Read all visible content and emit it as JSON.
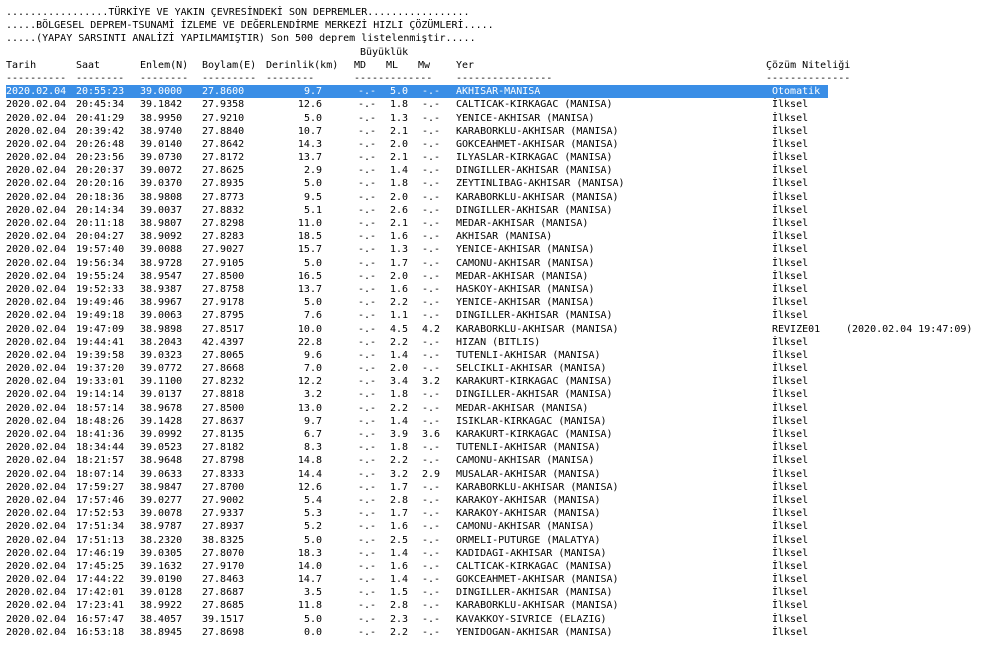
{
  "header": [
    ".................TÜRKİYE VE YAKIN ÇEVRESİNDEKİ SON DEPREMLER.................",
    ".....BÖLGESEL DEPREM-TSUNAMİ İZLEME VE DEĞERLENDİRME MERKEZİ HIZLI ÇÖZÜMLERİ.....",
    ".....(YAPAY SARSINTI ANALİZİ YAPILMAMIŞTIR) Son 500 deprem listelenmiştir....."
  ],
  "magnitude_group_label": "Büyüklük",
  "columns": {
    "date": "Tarih",
    "time": "Saat",
    "lat": "Enlem(N)",
    "lon": "Boylam(E)",
    "depth": "Derinlik(km)",
    "md": "MD",
    "ml": "ML",
    "mw": "Mw",
    "place": "Yer",
    "quality": "Çözüm Niteliği"
  },
  "dashes": {
    "date": "----------",
    "time": "--------",
    "lat": "--------",
    "lon": "---------",
    "depth": "--------",
    "mag": "-------------",
    "place": "----------------",
    "quality": "--------------"
  },
  "selected_row": 0,
  "rows": [
    [
      "2020.02.04",
      "20:55:23",
      "39.0000",
      "27.8600",
      "9.7",
      "-.-",
      "5.0",
      "-.-",
      "AKHISAR-MANISA",
      "Otomatik",
      ""
    ],
    [
      "2020.02.04",
      "20:45:34",
      "39.1842",
      "27.9358",
      "12.6",
      "-.-",
      "1.8",
      "-.-",
      "CALTICAK-KIRKAGAC (MANISA)",
      "İlksel",
      ""
    ],
    [
      "2020.02.04",
      "20:41:29",
      "38.9950",
      "27.9210",
      "5.0",
      "-.-",
      "1.3",
      "-.-",
      "YENICE-AKHISAR (MANISA)",
      "İlksel",
      ""
    ],
    [
      "2020.02.04",
      "20:39:42",
      "38.9740",
      "27.8840",
      "10.7",
      "-.-",
      "2.1",
      "-.-",
      "KARABORKLU-AKHISAR (MANISA)",
      "İlksel",
      ""
    ],
    [
      "2020.02.04",
      "20:26:48",
      "39.0140",
      "27.8642",
      "14.3",
      "-.-",
      "2.0",
      "-.-",
      "GOKCEAHMET-AKHISAR (MANISA)",
      "İlksel",
      ""
    ],
    [
      "2020.02.04",
      "20:23:56",
      "39.0730",
      "27.8172",
      "13.7",
      "-.-",
      "2.1",
      "-.-",
      "ILYASLAR-KIRKAGAC (MANISA)",
      "İlksel",
      ""
    ],
    [
      "2020.02.04",
      "20:20:37",
      "39.0072",
      "27.8625",
      "2.9",
      "-.-",
      "1.4",
      "-.-",
      "DINGILLER-AKHISAR (MANISA)",
      "İlksel",
      ""
    ],
    [
      "2020.02.04",
      "20:20:16",
      "39.0370",
      "27.8935",
      "5.0",
      "-.-",
      "1.8",
      "-.-",
      "ZEYTINLIBAG-AKHISAR (MANISA)",
      "İlksel",
      ""
    ],
    [
      "2020.02.04",
      "20:18:36",
      "38.9808",
      "27.8773",
      "9.5",
      "-.-",
      "2.0",
      "-.-",
      "KARABORKLU-AKHISAR (MANISA)",
      "İlksel",
      ""
    ],
    [
      "2020.02.04",
      "20:14:34",
      "39.0037",
      "27.8832",
      "5.1",
      "-.-",
      "2.6",
      "-.-",
      "DINGILLER-AKHISAR (MANISA)",
      "İlksel",
      ""
    ],
    [
      "2020.02.04",
      "20:11:18",
      "38.9807",
      "27.8298",
      "11.0",
      "-.-",
      "2.1",
      "-.-",
      "MEDAR-AKHISAR (MANISA)",
      "İlksel",
      ""
    ],
    [
      "2020.02.04",
      "20:04:27",
      "38.9092",
      "27.8283",
      "18.5",
      "-.-",
      "1.6",
      "-.-",
      "AKHISAR (MANISA)",
      "İlksel",
      ""
    ],
    [
      "2020.02.04",
      "19:57:40",
      "39.0088",
      "27.9027",
      "15.7",
      "-.-",
      "1.3",
      "-.-",
      "YENICE-AKHISAR (MANISA)",
      "İlksel",
      ""
    ],
    [
      "2020.02.04",
      "19:56:34",
      "38.9728",
      "27.9105",
      "5.0",
      "-.-",
      "1.7",
      "-.-",
      "CAMONU-AKHISAR (MANISA)",
      "İlksel",
      ""
    ],
    [
      "2020.02.04",
      "19:55:24",
      "38.9547",
      "27.8500",
      "16.5",
      "-.-",
      "2.0",
      "-.-",
      "MEDAR-AKHISAR (MANISA)",
      "İlksel",
      ""
    ],
    [
      "2020.02.04",
      "19:52:33",
      "38.9387",
      "27.8758",
      "13.7",
      "-.-",
      "1.6",
      "-.-",
      "HASKOY-AKHISAR (MANISA)",
      "İlksel",
      ""
    ],
    [
      "2020.02.04",
      "19:49:46",
      "38.9967",
      "27.9178",
      "5.0",
      "-.-",
      "2.2",
      "-.-",
      "YENICE-AKHISAR (MANISA)",
      "İlksel",
      ""
    ],
    [
      "2020.02.04",
      "19:49:18",
      "39.0063",
      "27.8795",
      "7.6",
      "-.-",
      "1.1",
      "-.-",
      "DINGILLER-AKHISAR (MANISA)",
      "İlksel",
      ""
    ],
    [
      "2020.02.04",
      "19:47:09",
      "38.9898",
      "27.8517",
      "10.0",
      "-.-",
      "4.5",
      "4.2",
      "KARABORKLU-AKHISAR (MANISA)",
      "REVIZE01",
      "(2020.02.04 19:47:09)"
    ],
    [
      "2020.02.04",
      "19:44:41",
      "38.2043",
      "42.4397",
      "22.8",
      "-.-",
      "2.2",
      "-.-",
      "HIZAN (BITLIS)",
      "İlksel",
      ""
    ],
    [
      "2020.02.04",
      "19:39:58",
      "39.0323",
      "27.8065",
      "9.6",
      "-.-",
      "1.4",
      "-.-",
      "TUTENLI-AKHISAR (MANISA)",
      "İlksel",
      ""
    ],
    [
      "2020.02.04",
      "19:37:20",
      "39.0772",
      "27.8668",
      "7.0",
      "-.-",
      "2.0",
      "-.-",
      "SELCIKLI-AKHISAR (MANISA)",
      "İlksel",
      ""
    ],
    [
      "2020.02.04",
      "19:33:01",
      "39.1100",
      "27.8232",
      "12.2",
      "-.-",
      "3.4",
      "3.2",
      "KARAKURT-KIRKAGAC (MANISA)",
      "İlksel",
      ""
    ],
    [
      "2020.02.04",
      "19:14:14",
      "39.0137",
      "27.8818",
      "3.2",
      "-.-",
      "1.8",
      "-.-",
      "DINGILLER-AKHISAR (MANISA)",
      "İlksel",
      ""
    ],
    [
      "2020.02.04",
      "18:57:14",
      "38.9678",
      "27.8500",
      "13.0",
      "-.-",
      "2.2",
      "-.-",
      "MEDAR-AKHISAR (MANISA)",
      "İlksel",
      ""
    ],
    [
      "2020.02.04",
      "18:48:26",
      "39.1428",
      "27.8637",
      "9.7",
      "-.-",
      "1.4",
      "-.-",
      "ISIKLAR-KIRKAGAC (MANISA)",
      "İlksel",
      ""
    ],
    [
      "2020.02.04",
      "18:41:36",
      "39.0992",
      "27.8135",
      "6.7",
      "-.-",
      "3.9",
      "3.6",
      "KARAKURT-KIRKAGAC (MANISA)",
      "İlksel",
      ""
    ],
    [
      "2020.02.04",
      "18:34:44",
      "39.0523",
      "27.8182",
      "8.3",
      "-.-",
      "1.8",
      "-.-",
      "TUTENLI-AKHISAR (MANISA)",
      "İlksel",
      ""
    ],
    [
      "2020.02.04",
      "18:21:57",
      "38.9648",
      "27.8798",
      "14.8",
      "-.-",
      "2.2",
      "-.-",
      "CAMONU-AKHISAR (MANISA)",
      "İlksel",
      ""
    ],
    [
      "2020.02.04",
      "18:07:14",
      "39.0633",
      "27.8333",
      "14.4",
      "-.-",
      "3.2",
      "2.9",
      "MUSALAR-AKHISAR (MANISA)",
      "İlksel",
      ""
    ],
    [
      "2020.02.04",
      "17:59:27",
      "38.9847",
      "27.8700",
      "12.6",
      "-.-",
      "1.7",
      "-.-",
      "KARABORKLU-AKHISAR (MANISA)",
      "İlksel",
      ""
    ],
    [
      "2020.02.04",
      "17:57:46",
      "39.0277",
      "27.9002",
      "5.4",
      "-.-",
      "2.8",
      "-.-",
      "KARAKOY-AKHISAR (MANISA)",
      "İlksel",
      ""
    ],
    [
      "2020.02.04",
      "17:52:53",
      "39.0078",
      "27.9337",
      "5.3",
      "-.-",
      "1.7",
      "-.-",
      "KARAKOY-AKHISAR (MANISA)",
      "İlksel",
      ""
    ],
    [
      "2020.02.04",
      "17:51:34",
      "38.9787",
      "27.8937",
      "5.2",
      "-.-",
      "1.6",
      "-.-",
      "CAMONU-AKHISAR (MANISA)",
      "İlksel",
      ""
    ],
    [
      "2020.02.04",
      "17:51:13",
      "38.2320",
      "38.8325",
      "5.0",
      "-.-",
      "2.5",
      "-.-",
      "ORMELI-PUTURGE (MALATYA)",
      "İlksel",
      ""
    ],
    [
      "2020.02.04",
      "17:46:19",
      "39.0305",
      "27.8070",
      "18.3",
      "-.-",
      "1.4",
      "-.-",
      "KADIDAGI-AKHISAR (MANISA)",
      "İlksel",
      ""
    ],
    [
      "2020.02.04",
      "17:45:25",
      "39.1632",
      "27.9170",
      "14.0",
      "-.-",
      "1.6",
      "-.-",
      "CALTICAK-KIRKAGAC (MANISA)",
      "İlksel",
      ""
    ],
    [
      "2020.02.04",
      "17:44:22",
      "39.0190",
      "27.8463",
      "14.7",
      "-.-",
      "1.4",
      "-.-",
      "GOKCEAHMET-AKHISAR (MANISA)",
      "İlksel",
      ""
    ],
    [
      "2020.02.04",
      "17:42:01",
      "39.0128",
      "27.8687",
      "3.5",
      "-.-",
      "1.5",
      "-.-",
      "DINGILLER-AKHISAR (MANISA)",
      "İlksel",
      ""
    ],
    [
      "2020.02.04",
      "17:23:41",
      "38.9922",
      "27.8685",
      "11.8",
      "-.-",
      "2.8",
      "-.-",
      "KARABORKLU-AKHISAR (MANISA)",
      "İlksel",
      ""
    ],
    [
      "2020.02.04",
      "16:57:47",
      "38.4057",
      "39.1517",
      "5.0",
      "-.-",
      "2.3",
      "-.-",
      "KAVAKKOY-SIVRICE (ELAZIG)",
      "İlksel",
      ""
    ],
    [
      "2020.02.04",
      "16:53:18",
      "38.8945",
      "27.8698",
      "0.0",
      "-.-",
      "2.2",
      "-.-",
      "YENIDOGAN-AKHISAR (MANISA)",
      "İlksel",
      ""
    ]
  ]
}
